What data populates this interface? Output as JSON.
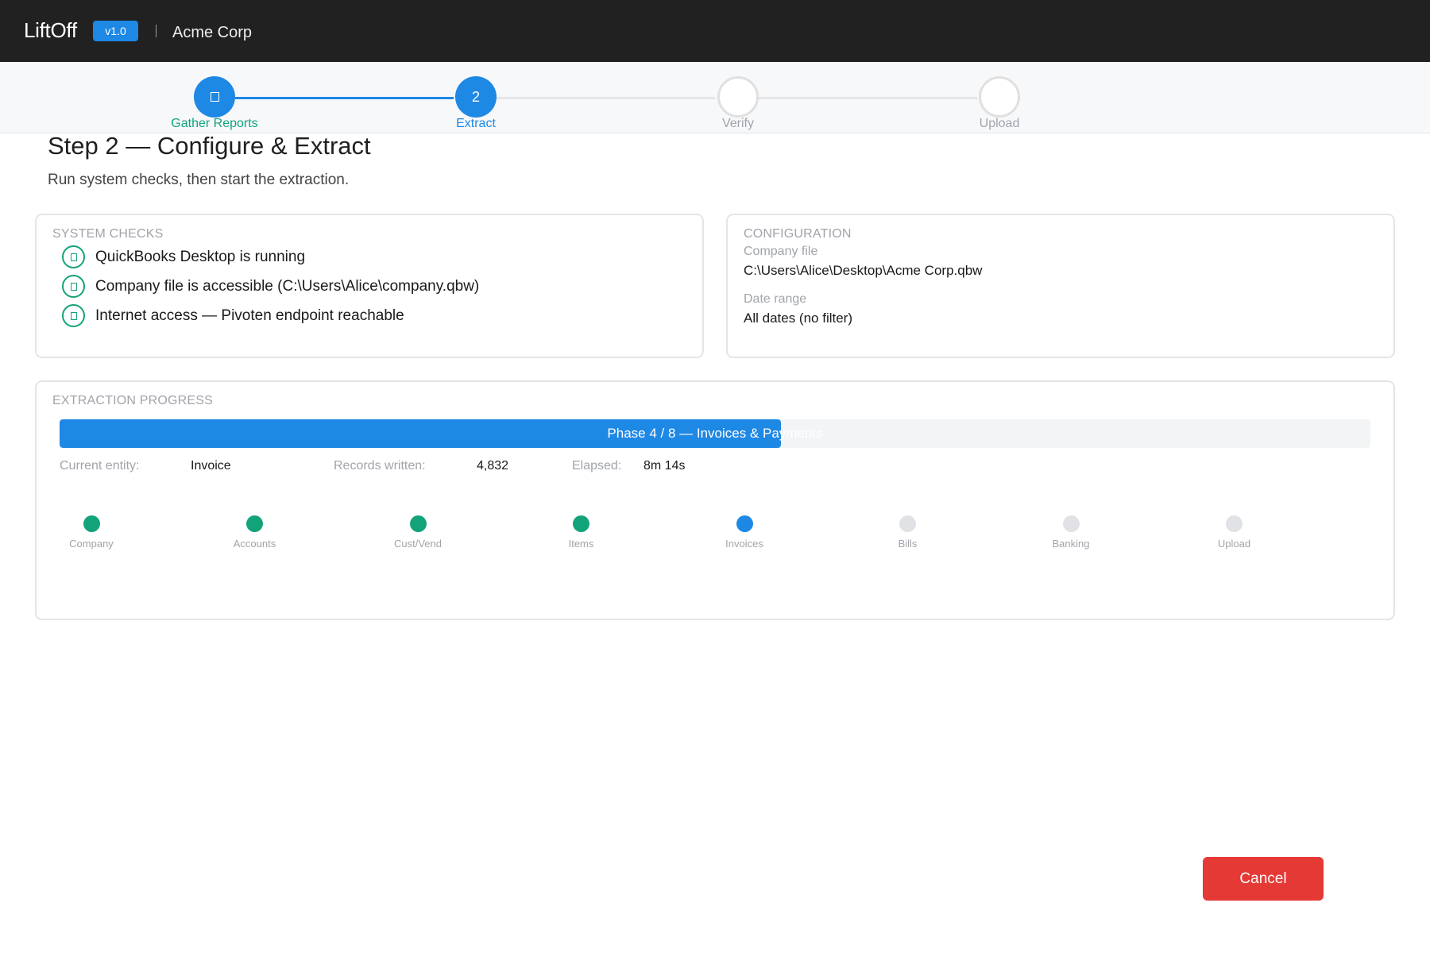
{
  "app": {
    "name": "LiftOff",
    "version": "v1.0",
    "company": "Acme Corp"
  },
  "stepper": {
    "steps": [
      {
        "label": "Gather Reports",
        "state": "done",
        "number": ""
      },
      {
        "label": "Extract",
        "state": "active",
        "number": "2"
      },
      {
        "label": "Verify",
        "state": "pending",
        "number": ""
      },
      {
        "label": "Upload",
        "state": "pending",
        "number": ""
      }
    ]
  },
  "page": {
    "title": "Step 2 — Configure & Extract",
    "subtitle": "Run system checks, then start the extraction."
  },
  "system_checks": {
    "title": "SYSTEM CHECKS",
    "items": [
      {
        "text": "QuickBooks Desktop is running",
        "status": "ok"
      },
      {
        "text": "Company file is accessible (C:\\Users\\Alice\\company.qbw)",
        "status": "ok"
      },
      {
        "text": "Internet access — Pivoten endpoint reachable",
        "status": "ok"
      }
    ]
  },
  "configuration": {
    "title": "CONFIGURATION",
    "company_file_label": "Company file",
    "company_file_value": "C:\\Users\\Alice\\Desktop\\Acme Corp.qbw",
    "date_range_label": "Date range",
    "date_range_value": "All dates (no filter)"
  },
  "extraction": {
    "title": "EXTRACTION PROGRESS",
    "progress_text": "Phase 4 / 8 — Invoices & Payments",
    "progress_fraction": 0.55,
    "current_entity_label": "Current entity:",
    "current_entity_value": "Invoice",
    "records_label": "Records written:",
    "records_value": "4,832",
    "elapsed_label": "Elapsed:",
    "elapsed_value": "8m 14s",
    "phases": [
      {
        "label": "Company",
        "state": "done"
      },
      {
        "label": "Accounts",
        "state": "done"
      },
      {
        "label": "Cust/Vend",
        "state": "done"
      },
      {
        "label": "Items",
        "state": "done"
      },
      {
        "label": "Invoices",
        "state": "active"
      },
      {
        "label": "Bills",
        "state": "pending"
      },
      {
        "label": "Banking",
        "state": "pending"
      },
      {
        "label": "Upload",
        "state": "pending"
      }
    ]
  },
  "actions": {
    "cancel_label": "Cancel"
  },
  "colors": {
    "accent": "#1e88e5",
    "success": "#13a37a",
    "danger": "#e53935",
    "pending": "#e0e2e6",
    "topbar": "#212121"
  }
}
